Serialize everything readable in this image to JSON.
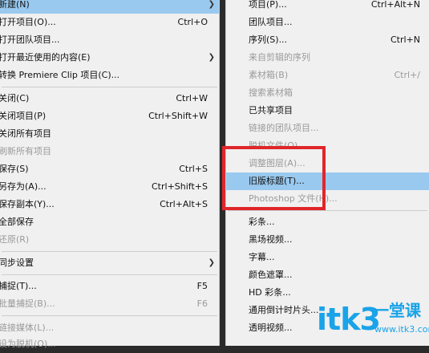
{
  "left_menu": [
    {
      "label": "新建(N)",
      "shortcut": "",
      "submenu": true,
      "disabled": false,
      "highlighted": true
    },
    {
      "label": "打开项目(O)...",
      "shortcut": "Ctrl+O",
      "submenu": false,
      "disabled": false
    },
    {
      "label": "打开团队项目...",
      "shortcut": "",
      "submenu": false,
      "disabled": false
    },
    {
      "label": "打开最近使用的内容(E)",
      "shortcut": "",
      "submenu": true,
      "disabled": false
    },
    {
      "label": "转换 Premiere Clip 项目(C)...",
      "shortcut": "",
      "submenu": false,
      "disabled": false
    },
    {
      "separator": true
    },
    {
      "label": "关闭(C)",
      "shortcut": "Ctrl+W",
      "submenu": false,
      "disabled": false
    },
    {
      "label": "关闭项目(P)",
      "shortcut": "Ctrl+Shift+W",
      "submenu": false,
      "disabled": false
    },
    {
      "label": "关闭所有项目",
      "shortcut": "",
      "submenu": false,
      "disabled": false
    },
    {
      "label": "刷新所有项目",
      "shortcut": "",
      "submenu": false,
      "disabled": true
    },
    {
      "label": "保存(S)",
      "shortcut": "Ctrl+S",
      "submenu": false,
      "disabled": false
    },
    {
      "label": "另存为(A)...",
      "shortcut": "Ctrl+Shift+S",
      "submenu": false,
      "disabled": false
    },
    {
      "label": "保存副本(Y)...",
      "shortcut": "Ctrl+Alt+S",
      "submenu": false,
      "disabled": false
    },
    {
      "label": "全部保存",
      "shortcut": "",
      "submenu": false,
      "disabled": false
    },
    {
      "label": "还原(R)",
      "shortcut": "",
      "submenu": false,
      "disabled": true
    },
    {
      "separator": true
    },
    {
      "label": "同步设置",
      "shortcut": "",
      "submenu": true,
      "disabled": false
    },
    {
      "separator": true
    },
    {
      "label": "捕捉(T)...",
      "shortcut": "F5",
      "submenu": false,
      "disabled": false
    },
    {
      "label": "批量捕捉(B)...",
      "shortcut": "F6",
      "submenu": false,
      "disabled": true
    },
    {
      "separator": true
    },
    {
      "label": "链接媒体(L)...",
      "shortcut": "",
      "submenu": false,
      "disabled": true
    },
    {
      "label": "设为脱机(O)...",
      "shortcut": "",
      "submenu": false,
      "disabled": true
    }
  ],
  "right_menu": [
    {
      "label": "项目(P)...",
      "shortcut": "Ctrl+Alt+N",
      "disabled": false
    },
    {
      "label": "团队项目...",
      "shortcut": "",
      "disabled": false
    },
    {
      "label": "序列(S)...",
      "shortcut": "Ctrl+N",
      "disabled": false
    },
    {
      "label": "来自剪辑的序列",
      "shortcut": "",
      "disabled": true
    },
    {
      "label": "素材箱(B)",
      "shortcut": "Ctrl+/",
      "disabled": true
    },
    {
      "label": "搜索素材箱",
      "shortcut": "",
      "disabled": true
    },
    {
      "label": "已共享项目",
      "shortcut": "",
      "disabled": false
    },
    {
      "label": "链接的团队项目...",
      "shortcut": "",
      "disabled": true
    },
    {
      "label": "脱机文件(O)...",
      "shortcut": "",
      "disabled": true
    },
    {
      "label": "调整图层(A)...",
      "shortcut": "",
      "disabled": true
    },
    {
      "label": "旧版标题(T)...",
      "shortcut": "",
      "disabled": false,
      "highlighted": true
    },
    {
      "label": "Photoshop 文件(H)...",
      "shortcut": "",
      "disabled": true
    },
    {
      "separator": true
    },
    {
      "label": "彩条...",
      "shortcut": "",
      "disabled": false
    },
    {
      "label": "黑场视频...",
      "shortcut": "",
      "disabled": false
    },
    {
      "label": "字幕...",
      "shortcut": "",
      "disabled": false
    },
    {
      "label": "颜色遮罩...",
      "shortcut": "",
      "disabled": false
    },
    {
      "label": "HD 彩条...",
      "shortcut": "",
      "disabled": false
    },
    {
      "label": "通用倒计时片头...",
      "shortcut": "",
      "disabled": false
    },
    {
      "label": "透明视频...",
      "shortcut": "",
      "disabled": false
    }
  ],
  "watermark": {
    "main": "itk3",
    "side": "一堂课",
    "url": "www.itk3.com"
  },
  "colors": {
    "highlight": "#99c9ef",
    "annotation": "#e0262b",
    "watermark": "#1aa3e8"
  }
}
